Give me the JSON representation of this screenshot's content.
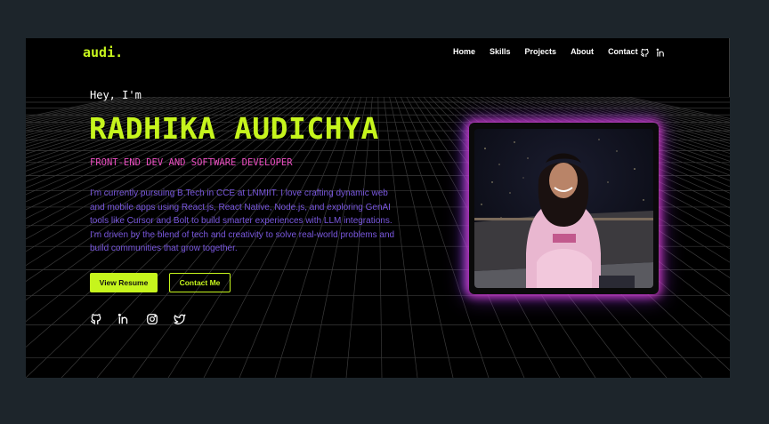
{
  "nav": {
    "logo": "audi.",
    "links": [
      "Home",
      "Skills",
      "Projects",
      "About",
      "Contact"
    ],
    "icons": [
      "github-icon",
      "linkedin-icon"
    ]
  },
  "hero": {
    "greeting": "Hey, I'm",
    "name": "RADHIKA AUDICHYA",
    "role": "FRONT-END DEV AND SOFTWARE DEVELOPER",
    "bio": "I'm currently pursuing B.Tech in CCE at LNMIIT. I love crafting dynamic web and mobile apps using React.js, React Native, Node.js, and exploring GenAI tools like Cursor and Bolt to build smarter experiences with LLM integrations. I'm driven by the blend of tech and creativity to solve real-world problems and build communities that grow together.",
    "primary_button": "View Resume",
    "secondary_button": "Contact Me",
    "socials": [
      "github-icon",
      "linkedin-icon",
      "instagram-icon",
      "twitter-icon"
    ]
  },
  "colors": {
    "accent": "#c6f51d",
    "pink": "#ec4ec2",
    "purple": "#7a58e0",
    "background": "#000000",
    "page": "#1d252b"
  }
}
